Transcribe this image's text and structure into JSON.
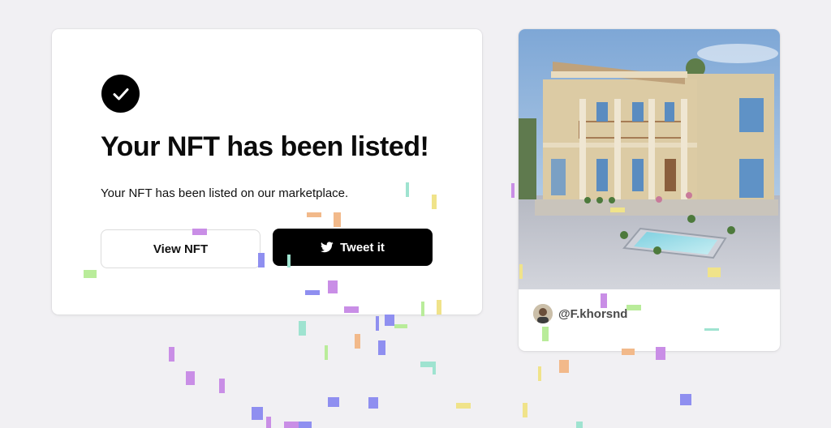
{
  "listing": {
    "icon": "check-icon",
    "title": "Your NFT has been listed!",
    "subtitle": "Your NFT has been listed on our marketplace.",
    "view_button": "View NFT",
    "tweet_button": "Tweet it",
    "tweet_icon": "twitter-bird-icon"
  },
  "nft": {
    "image": "house-with-balconies-and-pool",
    "owner_handle": "@F.khorsnd",
    "avatar": "owner-avatar"
  },
  "colors": {
    "background": "#f1f0f3",
    "primary_button": "#000000",
    "confetti": [
      "#8f8ff0",
      "#c98ee6",
      "#f2b98a",
      "#9fe3d0",
      "#f0e38a",
      "#b9ec9a"
    ]
  }
}
